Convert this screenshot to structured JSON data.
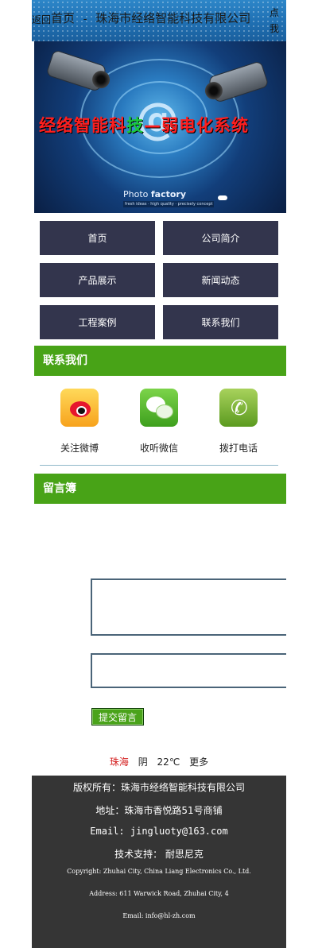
{
  "header": {
    "back_label": "返回",
    "home_label": "首页",
    "separator": "-",
    "company_title": "珠海市经络智能科技有限公司",
    "corner_label_top": "点",
    "corner_label_bottom": "我"
  },
  "banner": {
    "slogan_part1": "经络智能科",
    "slogan_part2": "技",
    "slogan_part3": "—弱电化系统",
    "brand_prefix": "Photo",
    "brand_name": "factory",
    "brand_tagline": "fresh ideas · high quality · precisely concept"
  },
  "nav": {
    "items": [
      {
        "label": "首页"
      },
      {
        "label": "公司简介"
      },
      {
        "label": "产品展示"
      },
      {
        "label": "新闻动态"
      },
      {
        "label": "工程案例"
      },
      {
        "label": "联系我们"
      }
    ]
  },
  "contact_section": {
    "title": "联系我们",
    "items": [
      {
        "label": "关注微博",
        "icon": "weibo-icon"
      },
      {
        "label": "收听微信",
        "icon": "wechat-icon"
      },
      {
        "label": "拨打电话",
        "icon": "phone-icon"
      }
    ]
  },
  "guestbook": {
    "title": "留言簿",
    "submit_label": "提交留言"
  },
  "weather": {
    "city": "珠海",
    "condition": "阴",
    "temperature": "22℃",
    "more": "更多"
  },
  "footer": {
    "copyright": "版权所有：珠海市经络智能科技有限公司",
    "address": "地址：珠海市香悦路51号商铺",
    "email": "Email: jingluoty@163.com",
    "support": "技术支持： 耐思尼克",
    "copyright_en": "Copyright: Zhuhai City, China Liang Electronics Co., Ltd.",
    "address_en": "Address: 611 Warwick Road, Zhuhai City, 4",
    "email_en": "Email: info@hl-zh.com"
  },
  "colors": {
    "header_blue": "#1f6fb2",
    "nav_button": "#33354d",
    "section_green": "#48a317",
    "footer_bg": "#353535",
    "city_red": "#d42020"
  }
}
